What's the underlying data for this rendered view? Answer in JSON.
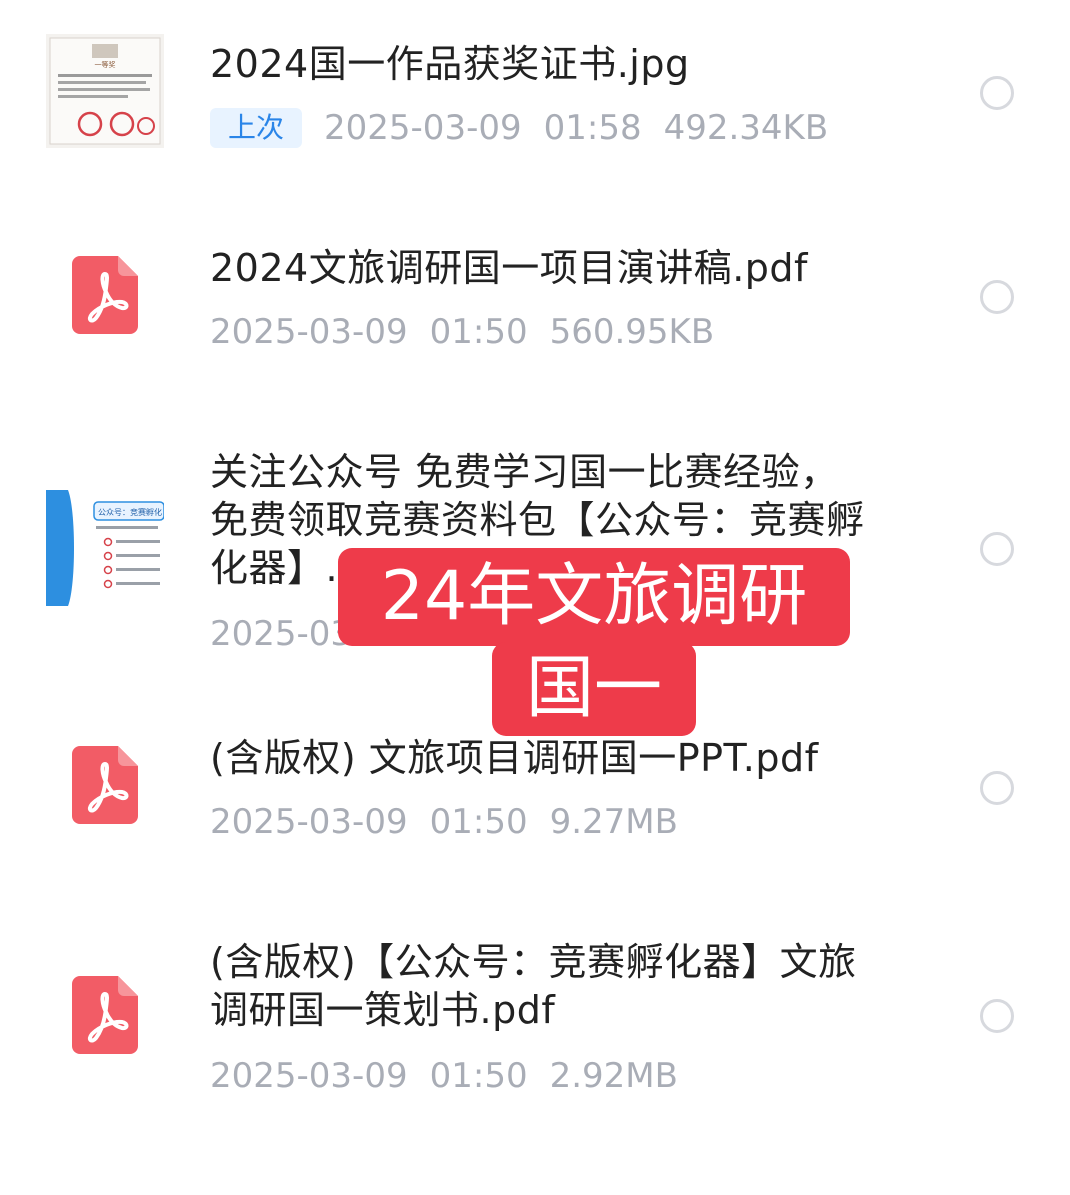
{
  "files": [
    {
      "icon": "certificate-image-thumbnail",
      "name": "2024国一作品获奖证书.jpg",
      "badge": "上次",
      "date": "2025-03-09",
      "time": "01:58",
      "size": "492.34KB"
    },
    {
      "icon": "pdf-icon",
      "name": "2024文旅调研国一项目演讲稿.pdf",
      "date": "2025-03-09",
      "time": "01:50",
      "size": "560.95KB"
    },
    {
      "icon": "promo-image-thumbnail",
      "name_line1": "关注公众号 免费学习国一比赛经验，",
      "name_line2": "免费领取竞赛资料包【公众号：竞赛孵",
      "name_line3": "化器】.",
      "date_partial": "2025-03"
    },
    {
      "icon": "pdf-icon",
      "name": "(含版权) 文旅项目调研国一PPT.pdf",
      "date": "2025-03-09",
      "time": "01:50",
      "size": "9.27MB"
    },
    {
      "icon": "pdf-icon",
      "name_line1": "(含版权)【公众号：竞赛孵化器】文旅",
      "name_line2": "调研国一策划书.pdf",
      "date": "2025-03-09",
      "time": "01:50",
      "size": "2.92MB"
    }
  ],
  "overlay": {
    "line1": "24年文旅调研",
    "line2": "国一"
  },
  "thumb_text": {
    "certificate_heading": "一等奖",
    "promo_header": "公众号：竞赛孵化"
  },
  "colors": {
    "pdf_red": "#f25c66",
    "overlay_red": "#ee3b4a",
    "badge_blue": "#2a85e8",
    "meta_gray": "#a9adb6"
  }
}
